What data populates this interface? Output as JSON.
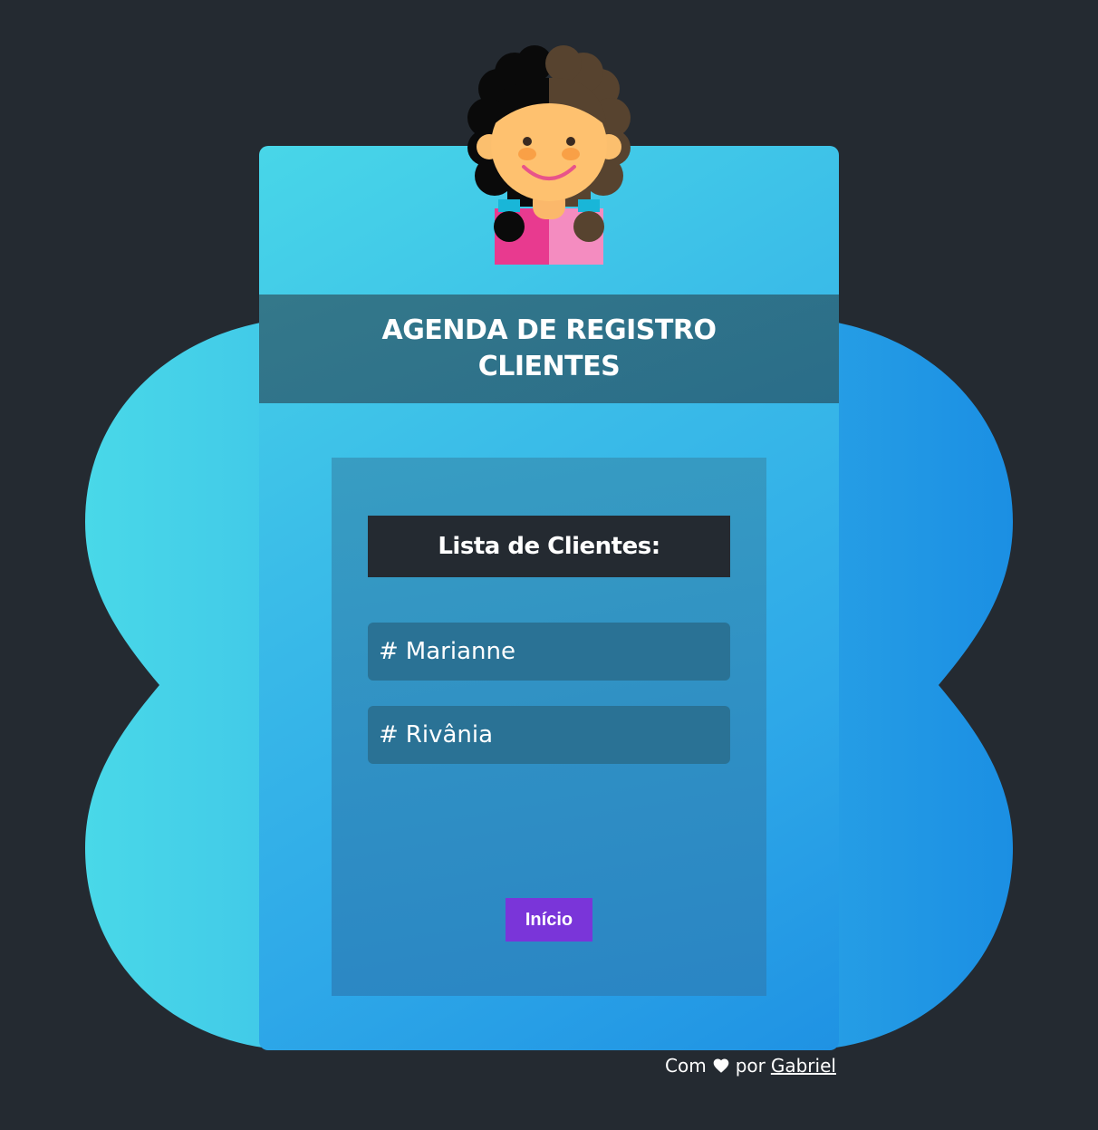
{
  "header": {
    "title": "AGENDA DE REGISTRO CLIENTES"
  },
  "list": {
    "heading": "Lista de Clientes:",
    "items": [
      {
        "hash": "#",
        "name": "Marianne"
      },
      {
        "hash": "#",
        "name": "Rivânia"
      }
    ]
  },
  "actions": {
    "inicio_label": "Início"
  },
  "footer": {
    "prefix": "Com",
    "middle": "por",
    "author": "Gabriel",
    "heart_icon": "heart-icon"
  },
  "colors": {
    "background": "#242a31",
    "card_gradient_start": "#48d6e8",
    "card_gradient_end": "#1f92e3",
    "header_band": "#2a6d89",
    "panel": "#2f8fc4",
    "list_heading_bg": "#242a31",
    "list_item_bg": "#2a7295",
    "button_bg": "#7a35d9"
  }
}
